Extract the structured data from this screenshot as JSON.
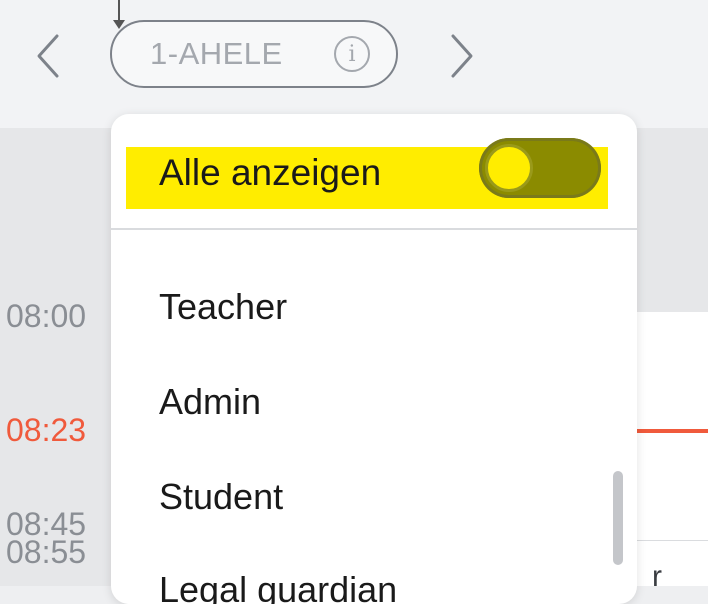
{
  "header": {
    "class_selector": "1-AHELE",
    "prev_icon": "chevron-left-icon",
    "next_icon": "chevron-right-icon",
    "info_icon": "info-icon",
    "info_glyph": "i"
  },
  "timeline": {
    "times": [
      "08:00",
      "08:23",
      "08:45",
      "08:55"
    ],
    "current_time": "08:23",
    "accent_color": "#f05a3c",
    "partial_text": "r"
  },
  "dropdown": {
    "toggle_label": "Alle anzeigen",
    "toggle_on": true,
    "highlight_color": "#ffed00",
    "roles": [
      "Teacher",
      "Admin",
      "Student",
      "Legal guardian"
    ]
  }
}
